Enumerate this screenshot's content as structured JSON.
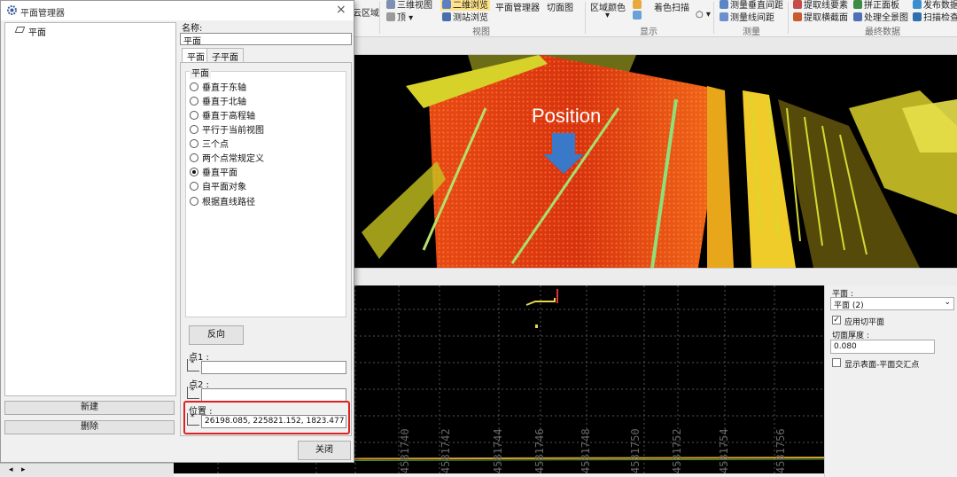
{
  "ribbon": {
    "items": {
      "yunquyu": "云区域",
      "sanwei": "三维视图",
      "erwei": "二维浏览",
      "ding": "顶",
      "cezhan": "测站浏览",
      "pingmian_mgr": "平面管理器",
      "qiemiantu": "切面图",
      "quyuyanse": "区域颜色",
      "zhuose": "着色扫描",
      "celiang_ju": "测量垂直间距",
      "celiang_xian": "测量线间距",
      "tiqu_yaosu": "提取线要素",
      "tiqu_hengjie": "提取横截面",
      "chuli": "处理全景图",
      "saomiao": "扫描检查",
      "pingzheng": "拼正面板",
      "fafang": "发布数据"
    },
    "groups": {
      "shitu": "视图",
      "xianshi": "显示",
      "celiang": "测量",
      "zuizhong": "最终数据"
    }
  },
  "view3d": {
    "annotation": "Position"
  },
  "section": {
    "ticks": [
      "4581740",
      "4581742",
      "4581744",
      "4581746",
      "4581748",
      "4581750",
      "4581752",
      "4581754",
      "4581756"
    ]
  },
  "right_panel": {
    "plane_label": "平面 :",
    "plane_value": "平面 (2)",
    "apply_cut": "应用切平面",
    "thickness_label": "切面厚度 :",
    "thickness_value": "0.080",
    "show_intersection": "显示表面-平面交汇点"
  },
  "dialog": {
    "title": "平面管理器",
    "tree_item": "平面",
    "name_label": "名称:",
    "name_value": "平面",
    "tabs": [
      "平面",
      "子平面"
    ],
    "group_label": "平面",
    "options": [
      "垂直于东轴",
      "垂直于北轴",
      "垂直于高程轴",
      "平行于当前视图",
      "三个点",
      "两个点常规定义",
      "垂直平面",
      "自平面对象",
      "根据直线路径"
    ],
    "selected_option": "垂直平面",
    "reverse_button": "反向",
    "point1_label": "点1 :",
    "point2_label": "点2 :",
    "position_label": "位置 :",
    "position_value": "26198.085, 225821.152, 1823.477",
    "new_button": "新建",
    "delete_button": "删除",
    "close_button": "关闭"
  }
}
